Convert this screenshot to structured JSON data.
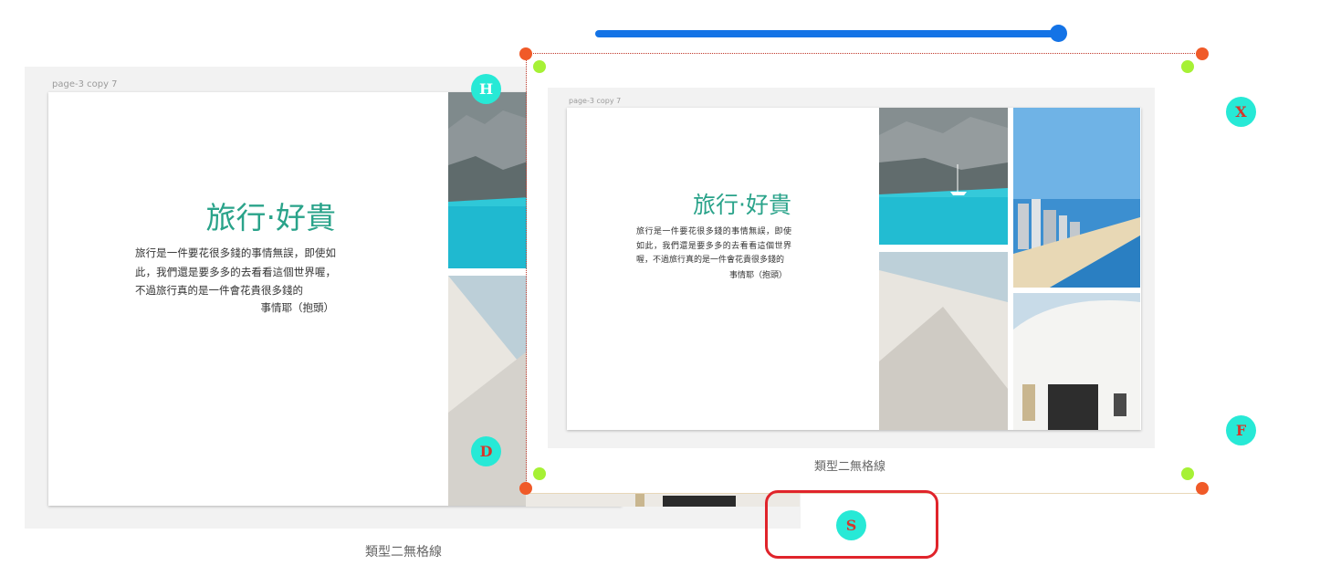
{
  "slider": {
    "value_percent": 100
  },
  "background_artboard": {
    "label": "page-3 copy 7",
    "title": "旅行‧好貴",
    "body": "旅行是一件要花很多錢的事情無誤，即使如此，我們還是要多多的去看看這個世界喔，不過旅行真的是一件會花貴很多錢的",
    "body_end": "事情耶（抱頭）",
    "caption": "類型二無格線"
  },
  "overlay_artboard": {
    "label": "page-3 copy 7",
    "title": "旅行‧好貴",
    "body": "旅行是一件要花很多錢的事情無誤，即使如此，我們還是要多多的去看看這個世界喔，不過旅行真的是一件會花貴很多錢的",
    "body_end": "事情耶（抱頭）",
    "caption": "類型二無格線"
  },
  "markers": {
    "h": "H",
    "x": "X",
    "f": "F",
    "d": "D",
    "s": "S"
  },
  "colors": {
    "accent_title": "#2aa38a",
    "slider": "#1473e6",
    "handle_corner": "#f05a28",
    "handle_rotate": "#a6f135",
    "marker_fill": "#27e9d6",
    "highlight_box": "#e0242b"
  }
}
